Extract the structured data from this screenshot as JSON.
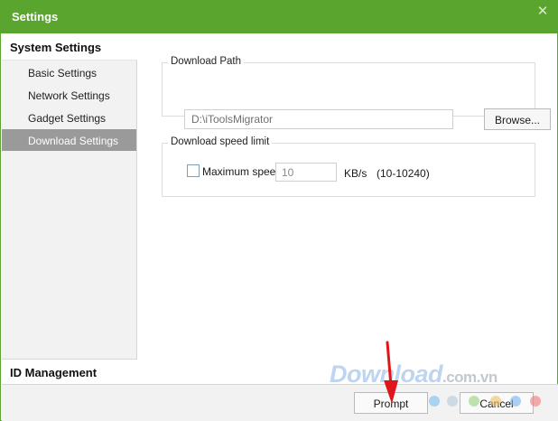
{
  "window": {
    "title": "Settings",
    "close_glyph": "✕"
  },
  "sidebar": {
    "header": "System Settings",
    "items": [
      {
        "label": "Basic Settings"
      },
      {
        "label": "Network Settings"
      },
      {
        "label": "Gadget Settings"
      },
      {
        "label": "Download Settings"
      }
    ],
    "selected_index": 3,
    "footer": "ID Management"
  },
  "download_path": {
    "group_label": "Download Path",
    "path_value": "D:\\iToolsMigrator",
    "browse_label": "Browse..."
  },
  "speed_limit": {
    "group_label": "Download speed limit",
    "checkbox_label": "Maximum speed",
    "checked": false,
    "value": "10",
    "unit": "KB/s",
    "range": "(10-10240)"
  },
  "buttons": {
    "prompt": "Prompt",
    "cancel": "Cancel"
  },
  "watermark": {
    "main": "Download",
    "suffix": ".com.vn"
  },
  "colors": {
    "accent": "#5aa52e",
    "selected_item": "#9a9a9a",
    "arrow": "#e0151c"
  }
}
